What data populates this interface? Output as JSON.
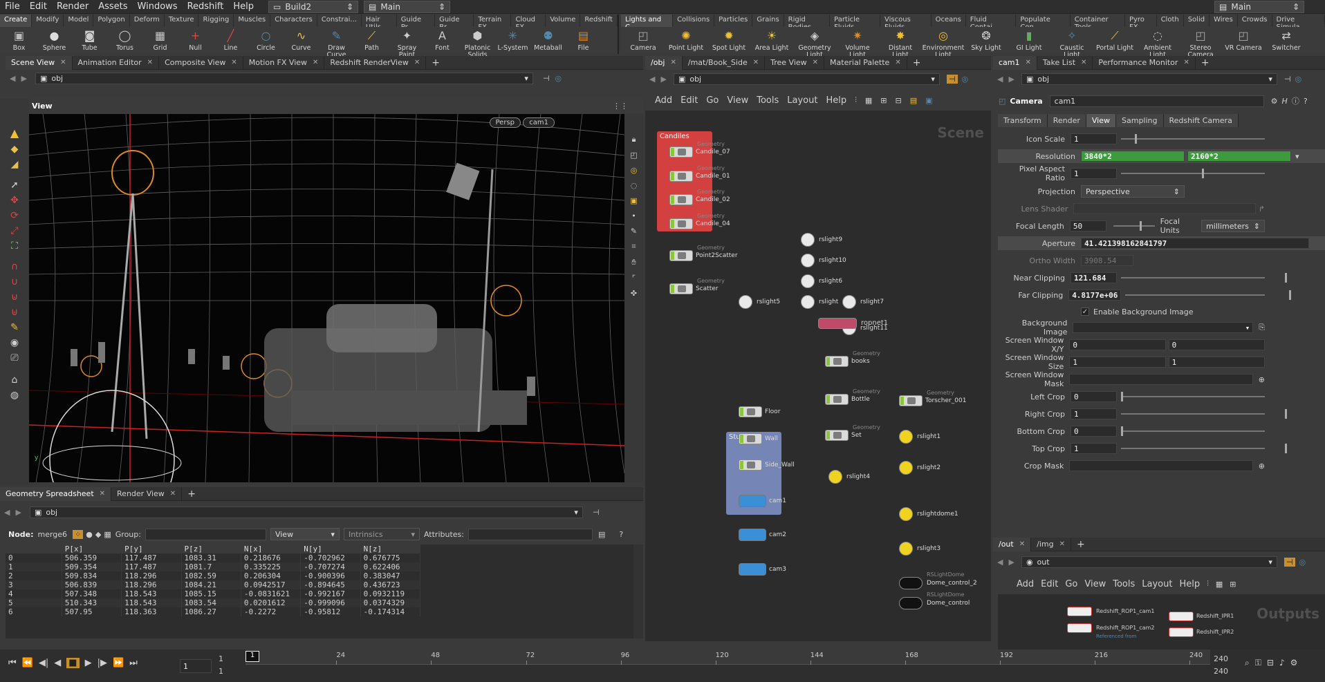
{
  "menubar": {
    "items": [
      "File",
      "Edit",
      "Render",
      "Assets",
      "Windows",
      "Redshift",
      "Help"
    ],
    "desktop": "Build2",
    "context": "Main",
    "right_context": "Main"
  },
  "shelf_left": {
    "tabs": [
      "Create",
      "Modify",
      "Model",
      "Polygon",
      "Deform",
      "Texture",
      "Rigging",
      "Muscles",
      "Characters",
      "Constrai...",
      "Hair Utils",
      "Guide Pr...",
      "Guide Br...",
      "Terrain FX",
      "Cloud FX",
      "Volume",
      "Redshift"
    ],
    "tools": [
      "Box",
      "Sphere",
      "Tube",
      "Torus",
      "Grid",
      "Null",
      "Line",
      "Circle",
      "Curve",
      "Draw Curve",
      "Path",
      "Spray Paint",
      "Font",
      "Platonic Solids",
      "L-System",
      "Metaball",
      "File"
    ]
  },
  "shelf_right": {
    "tabs": [
      "Lights and C...",
      "Collisions",
      "Particles",
      "Grains",
      "Rigid Bodies",
      "Particle Fluids",
      "Viscous Fluids",
      "Oceans",
      "Fluid Contai...",
      "Populate Con...",
      "Container Tools",
      "Pyro FX",
      "Cloth",
      "Solid",
      "Wires",
      "Crowds",
      "Drive Simula..."
    ],
    "tools": [
      "Camera",
      "Point Light",
      "Spot Light",
      "Area Light",
      "Geometry Light",
      "Volume Light",
      "Distant Light",
      "Environment Light",
      "Sky Light",
      "GI Light",
      "Caustic Light",
      "Portal Light",
      "Ambient Light",
      "Stereo Camera",
      "VR Camera",
      "Switcher"
    ]
  },
  "viewport": {
    "tabs": [
      "Scene View",
      "Animation Editor",
      "Composite View",
      "Motion FX View",
      "Redshift RenderView"
    ],
    "path": "obj",
    "title": "View",
    "persp": "Persp",
    "cam": "cam1"
  },
  "spreadsheet": {
    "tabs": [
      "Geometry Spreadsheet",
      "Render View"
    ],
    "path": "obj",
    "node_label": "Node:",
    "node": "merge6",
    "group_label": "Group:",
    "view": "View",
    "intrinsics": "Intrinsics",
    "attributes_label": "Attributes:",
    "columns": [
      "",
      "P[x]",
      "P[y]",
      "P[z]",
      "N[x]",
      "N[y]",
      "N[z]"
    ],
    "rows": [
      [
        "0",
        "506.359",
        "117.487",
        "1083.31",
        "0.218676",
        "-0.702962",
        "0.676775"
      ],
      [
        "1",
        "509.354",
        "117.487",
        "1081.7",
        "0.335225",
        "-0.707274",
        "0.622406"
      ],
      [
        "2",
        "509.834",
        "118.296",
        "1082.59",
        "0.206304",
        "-0.900396",
        "0.383047"
      ],
      [
        "3",
        "506.839",
        "118.296",
        "1084.21",
        "0.0942517",
        "-0.894645",
        "0.436723"
      ],
      [
        "4",
        "507.348",
        "118.543",
        "1085.15",
        "-0.0831621",
        "-0.992167",
        "0.0932119"
      ],
      [
        "5",
        "510.343",
        "118.543",
        "1083.54",
        "0.0201612",
        "-0.999096",
        "0.0374329"
      ],
      [
        "6",
        "507.95",
        "118.363",
        "1086.27",
        "-0.2272",
        "-0.95812",
        "-0.174314"
      ]
    ]
  },
  "network": {
    "tabs": [
      "/obj",
      "/mat/Book_Side",
      "Tree View",
      "Material Palette"
    ],
    "path": "obj",
    "menu": [
      "Add",
      "Edit",
      "Go",
      "View",
      "Tools",
      "Layout",
      "Help"
    ],
    "watermark": "Scene",
    "box_candles": "Candiles",
    "box_studia": "Studia",
    "geo_sub": "Geometry",
    "rs_sub": "RSLightDome",
    "nodes": {
      "candle07": "Candile_07",
      "candle01": "Candile_01",
      "candle02": "Candile_02",
      "candle04": "Candile_04",
      "p2s": "Point2Scatter",
      "scatter": "Scatter",
      "rs9": "rslight9",
      "rs10": "rslight10",
      "rs6": "rslight6",
      "rs5": "rslight5",
      "rsx": "rslight",
      "rs7": "rslight7",
      "rs11": "rslight11",
      "ropnet": "ropnet1",
      "books": "books",
      "floor": "Floor",
      "wall": "Wall",
      "side": "Side_Wall",
      "bottle": "Bottle",
      "set": "Set",
      "torscher": "Torscher_001",
      "rs1": "rslight1",
      "rs2": "rslight2",
      "rs4": "rslight4",
      "dome1": "rslightdome1",
      "rs3": "rslight3",
      "cam1": "cam1",
      "cam2": "cam2",
      "cam3": "cam3",
      "dc2": "Dome_control_2",
      "dc": "Dome_control"
    }
  },
  "params": {
    "tabs": [
      "cam1",
      "Take List",
      "Performance Monitor"
    ],
    "path": "obj",
    "type": "Camera",
    "name": "cam1",
    "subtabs": [
      "Transform",
      "Render",
      "View",
      "Sampling",
      "Redshift Camera"
    ],
    "icon_scale": "1",
    "resolution_x": "3840*2",
    "resolution_y": "2160*2",
    "pixel_aspect": "1",
    "projection": "Perspective",
    "focal_length": "50",
    "focal_units_label": "Focal Units",
    "focal_units": "millimeters",
    "aperture": "41.421398162841797",
    "ortho_width": "3908.54",
    "near": "121.684",
    "far": "4.8177e+06",
    "enable_bg": "Enable Background Image",
    "sw_x": "0",
    "sw_y": "0",
    "sws_x": "1",
    "sws_y": "1",
    "left_crop": "0",
    "right_crop": "1",
    "bottom_crop": "0",
    "top_crop": "1",
    "labels": {
      "icon_scale": "Icon Scale",
      "resolution": "Resolution",
      "pixel_aspect": "Pixel Aspect Ratio",
      "projection": "Projection",
      "lens": "Lens Shader",
      "focal": "Focal Length",
      "aperture": "Aperture",
      "ortho": "Ortho Width",
      "near": "Near Clipping",
      "far": "Far Clipping",
      "bg": "Background Image",
      "swxy": "Screen Window X/Y",
      "sws": "Screen Window Size",
      "swm": "Screen Window Mask",
      "lc": "Left Crop",
      "rc": "Right Crop",
      "bc": "Bottom Crop",
      "tc": "Top Crop",
      "cm": "Crop Mask"
    }
  },
  "outputs": {
    "tabs": [
      "/out",
      "/img"
    ],
    "path": "out",
    "menu": [
      "Add",
      "Edit",
      "Go",
      "View",
      "Tools",
      "Layout",
      "Help"
    ],
    "watermark": "Outputs",
    "nodes": [
      "Redshift_ROP1_cam1",
      "Redshift_ROP1_cam2",
      "Redshift_IPR1",
      "Redshift_IPR2"
    ],
    "ref": "Referenced from"
  },
  "timeline": {
    "frame": "1",
    "start": "1",
    "start2": "1",
    "end": "240",
    "end2": "240",
    "current": "1",
    "ticks": [
      "24",
      "48",
      "72",
      "96",
      "120",
      "144",
      "168",
      "192",
      "216"
    ],
    "tick_ends": [
      "1",
      "240"
    ]
  },
  "colors": {
    "accent": "#f0a020",
    "green": "#3d9a3d",
    "candle_box": "#d24040",
    "studia_box": "#7d8fc4"
  }
}
